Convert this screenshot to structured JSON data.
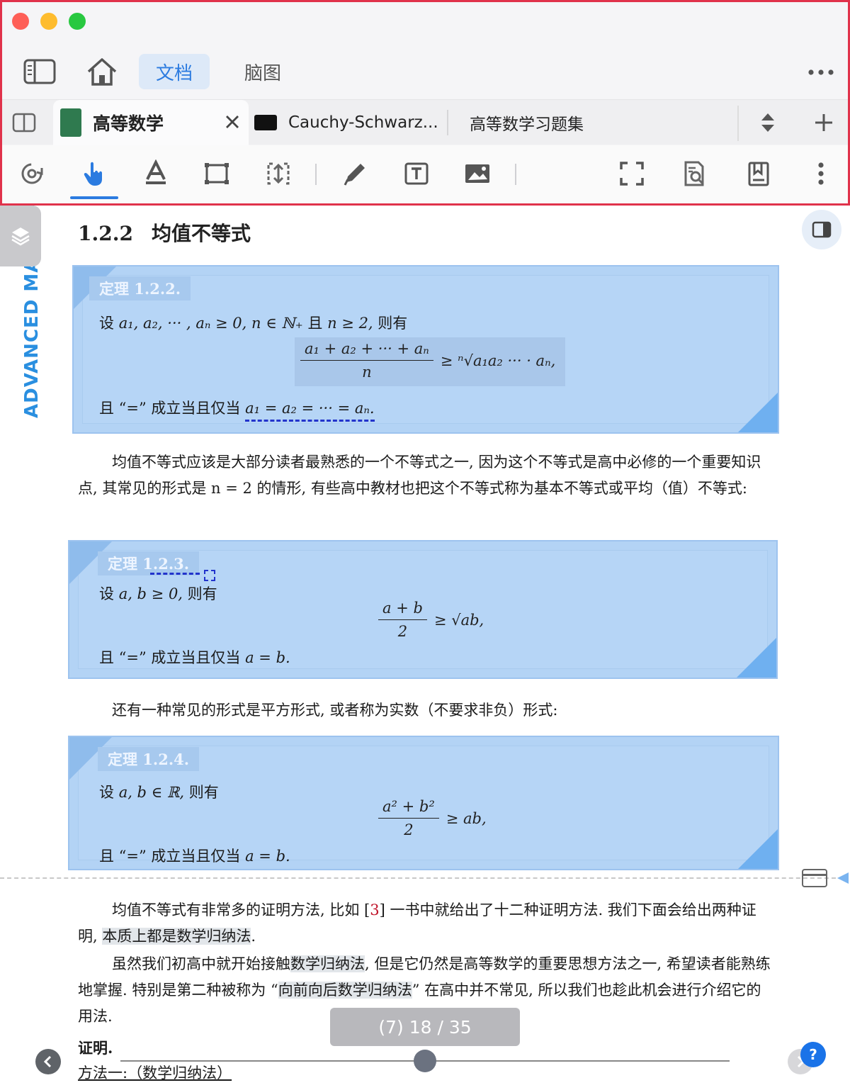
{
  "nav": {
    "tab_doc": "文档",
    "tab_mindmap": "脑图"
  },
  "tabs": [
    {
      "title": "高等数学"
    },
    {
      "title": "Cauchy-Schwarz..."
    },
    {
      "title": "高等数学习题集"
    }
  ],
  "sidebar": {
    "vertical_title": "ADVANCED MATHEMATI"
  },
  "section": {
    "number": "1.2.2",
    "title": "均值不等式"
  },
  "theorem1": {
    "label": "定理 1.2.2.",
    "premise_prefix": "设",
    "premise_math": "a₁, a₂, ··· , aₙ ≥ 0, n ∈ ℕ₊",
    "premise_mid": "且",
    "premise_math2": "n ≥ 2,",
    "premise_suffix": "则有",
    "formula_num": "a₁ + a₂ + ··· + aₙ",
    "formula_den": "n",
    "formula_rhs": "≥ ⁿ√a₁a₂ ··· · aₙ,",
    "condition_prefix": "且 “=” 成立当且仅当",
    "condition_math": "a₁ = a₂ = ··· = aₙ."
  },
  "para1": "均值不等式应该是大部分读者最熟悉的一个不等式之一, 因为这个不等式是高中必修的一个重要知识点, 其常见的形式是 n = 2 的情形, 有些高中教材也把这个不等式称为基本不等式或平均（值）不等式:",
  "theorem2": {
    "label": "定理 1.2.3.",
    "premise_prefix": "设",
    "premise_math": "a, b ≥ 0,",
    "premise_suffix": "则有",
    "formula_num": "a + b",
    "formula_den": "2",
    "formula_rhs": "≥ √ab,",
    "condition_prefix": "且 “=” 成立当且仅当",
    "condition_math": "a = b."
  },
  "para2": "还有一种常见的形式是平方形式, 或者称为实数（不要求非负）形式:",
  "theorem3": {
    "label": "定理 1.2.4.",
    "premise_prefix": "设",
    "premise_math": "a, b ∈ ℝ,",
    "premise_suffix": "则有",
    "formula_num": "a² + b²",
    "formula_den": "2",
    "formula_rhs": "≥ ab,",
    "condition_prefix": "且 “=” 成立当且仅当",
    "condition_math": "a = b."
  },
  "para3": {
    "a": "均值不等式有非常多的证明方法, 比如 [",
    "ref": "3",
    "b": "] 一书中就给出了十二种证明方法. 我们下面会给出两种证明, ",
    "hl": "本质上都是数学归纳法",
    "c": "."
  },
  "para4": {
    "a": "虽然我们初高中就开始接触",
    "hl1": "数学归纳法",
    "b": ", 但是它仍然是高等数学的重要思想方法之一, 希望读者能熟练地掌握. 特别是第二种被称为 “",
    "hl2": "向前向后数学归纳法",
    "c": "” 在高中并不常见, 所以我们也趁此机会进行介绍它的用法."
  },
  "proof_label": "证明.",
  "method_label": "方法一:（数学归纳法）",
  "page_indicator": "(7) 18 / 35",
  "help_label": "?",
  "colors": {
    "accent": "#2b7be0",
    "theorem_bg": "#b3d3f5",
    "border_highlight": "#e0324b"
  },
  "icons": [
    "sidebar-toggle-icon",
    "home-icon",
    "more-icon",
    "split-view-icon",
    "close-icon",
    "sort-icon",
    "plus-icon",
    "auto-scroll-icon",
    "hand-pointer-icon",
    "text-select-icon",
    "area-select-icon",
    "resize-icon",
    "pen-icon",
    "text-box-icon",
    "image-icon",
    "fullscreen-icon",
    "search-document-icon",
    "bookmark-icon",
    "vertical-more-icon"
  ]
}
